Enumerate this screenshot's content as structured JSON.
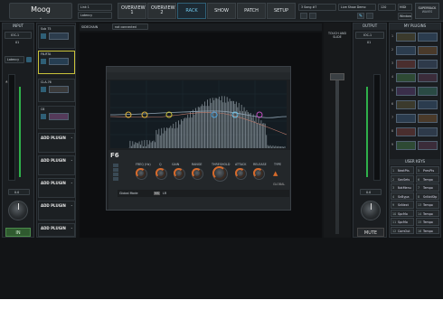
{
  "preset": {
    "name": "Moog"
  },
  "header": {
    "link_label": "Link 1",
    "latency_label": "Latency",
    "tabs": [
      {
        "label": "OVERVIEW 1"
      },
      {
        "label": "OVERVIEW 2"
      },
      {
        "label": "RACK"
      },
      {
        "label": "SHOW"
      },
      {
        "label": "PATCH"
      },
      {
        "label": "SETUP"
      }
    ],
    "active_tab": "RACK",
    "song": "3 Song #7",
    "show": "Live Show Demo",
    "tempo": "120",
    "midi": "MIDI",
    "window": "Window",
    "logo_line1": "SUPERRACK",
    "logo_line2": "WAVES"
  },
  "input": {
    "title": "INPUT",
    "device": "IOC-1",
    "channel": "01",
    "latency": "Latency",
    "level": "0.0",
    "in_button": "IN"
  },
  "rack": {
    "slots": [
      {
        "name": "Sub 75",
        "selected": false
      },
      {
        "name": "F6-RTA",
        "selected": true
      },
      {
        "name": "CLA-76",
        "selected": false
      },
      {
        "name": "C6",
        "selected": false
      }
    ],
    "add_plugin": "ADD PLUGIN",
    "add_count": 5
  },
  "sidechain": {
    "label": "SIDECHAIN",
    "value": "not connected"
  },
  "plugin": {
    "name": "F6",
    "band_labels": [
      "FREQ (Hz)",
      "Q",
      "GAIN",
      "RANGE",
      "THRESHOLD",
      "ATTACK",
      "RELEASE",
      "TYPE"
    ],
    "global_label": "GLOBAL",
    "bottom_labels": [
      "Global Mode",
      "MS",
      "LR"
    ]
  },
  "touch_slide": {
    "label": "TOUCH AND SLIDE"
  },
  "output": {
    "title": "OUTPUT",
    "device": "IOC-1",
    "channel": "01",
    "level": "0.0",
    "mute": "MUTE"
  },
  "browser": {
    "title": "MY PLUGINS",
    "items": [
      "",
      "",
      "",
      "",
      "",
      "",
      "",
      "",
      ""
    ]
  },
  "user_keys": {
    "title": "USER KEYS",
    "keys": [
      [
        "1",
        "NextPts",
        "5",
        "PrevPts"
      ],
      [
        "2",
        "SavSets",
        "6",
        "Tempo"
      ],
      [
        "3",
        "NxtMenu",
        "7",
        "Tempo"
      ],
      [
        "4",
        "SnBypa",
        "8",
        "SnNxtStp"
      ],
      [
        "9",
        "SnNext",
        "13",
        "Tempo"
      ],
      [
        "10",
        "SpcMo",
        "14",
        "Tempo"
      ],
      [
        "11",
        "SpcMo",
        "15",
        "Tempo"
      ],
      [
        "12",
        "ComOut",
        "16",
        "Tempo"
      ]
    ]
  },
  "colors": {
    "accent": "#6fc6ea",
    "knob_ring": "#d66a2b",
    "selected_slot": "#c9c23a",
    "in_green": "#2f5a2f"
  }
}
